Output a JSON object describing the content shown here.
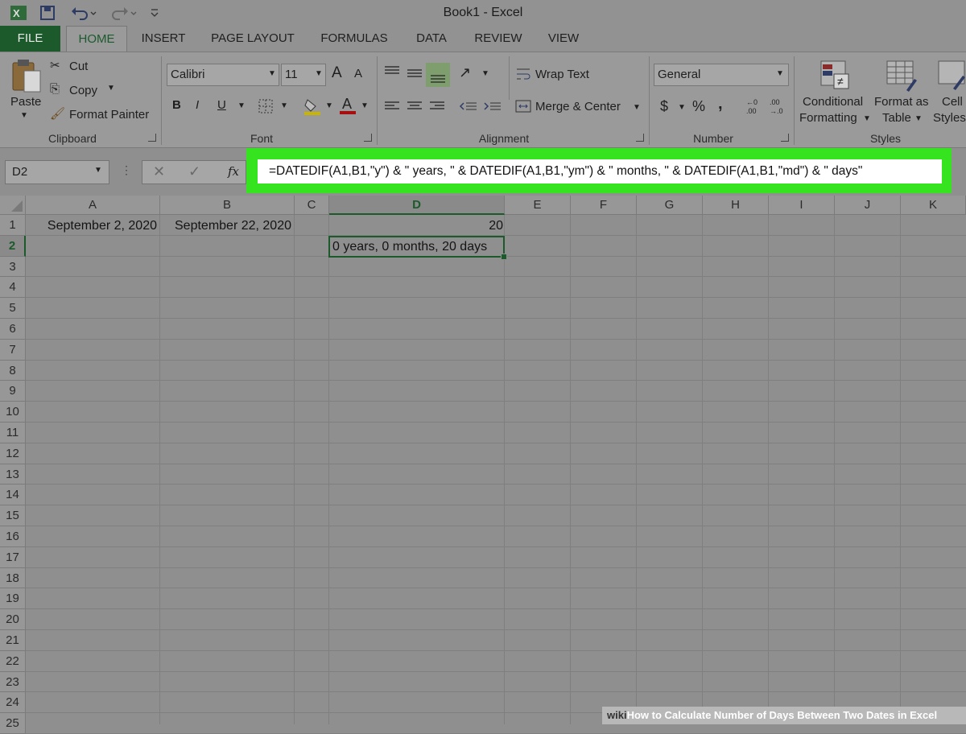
{
  "window": {
    "title": "Book1 - Excel"
  },
  "quick_access": {
    "excel_icon": "excel-icon",
    "save_icon": "save-icon",
    "undo_icon": "undo-icon",
    "redo_icon": "redo-icon",
    "customize_icon": "customize-icon"
  },
  "tabs": [
    {
      "label": "FILE"
    },
    {
      "label": "HOME"
    },
    {
      "label": "INSERT"
    },
    {
      "label": "PAGE LAYOUT"
    },
    {
      "label": "FORMULAS"
    },
    {
      "label": "DATA"
    },
    {
      "label": "REVIEW"
    },
    {
      "label": "VIEW"
    }
  ],
  "clipboard": {
    "paste": "Paste",
    "cut": "Cut",
    "copy": "Copy",
    "format_painter": "Format Painter",
    "label": "Clipboard"
  },
  "font": {
    "name": "Calibri",
    "size": "11",
    "bold": "B",
    "italic": "I",
    "underline": "U",
    "grow": "A",
    "shrink": "A",
    "label": "Font"
  },
  "alignment": {
    "wrap_text": "Wrap Text",
    "merge_center": "Merge & Center",
    "label": "Alignment"
  },
  "number": {
    "format": "General",
    "currency": "$",
    "percent": "%",
    "comma": ",",
    "label": "Number"
  },
  "styles": {
    "conditional_1": "Conditional",
    "conditional_2": "Formatting",
    "format_table_1": "Format as",
    "format_table_2": "Table",
    "cell_styles_1": "Cell",
    "cell_styles_2": "Styles",
    "label": "Styles"
  },
  "formula_bar": {
    "name_box": "D2",
    "fx": "fx",
    "formula": "=DATEDIF(A1,B1,\"y\") & \" years, \" & DATEDIF(A1,B1,\"ym\") & \" months, \" & DATEDIF(A1,B1,\"md\") & \" days\"",
    "highlight_color": "#35e41e"
  },
  "columns": [
    "A",
    "B",
    "C",
    "D",
    "E",
    "F",
    "G",
    "H",
    "I",
    "J",
    "K"
  ],
  "rows": [
    "1",
    "2",
    "3",
    "4",
    "5",
    "6",
    "7",
    "8",
    "9",
    "10",
    "11",
    "12",
    "13",
    "14",
    "15",
    "16",
    "17",
    "18",
    "19",
    "20",
    "21",
    "22",
    "23",
    "24",
    "25"
  ],
  "cells": {
    "A1": "September 2, 2020",
    "B1": "September 22, 2020",
    "D1": "20",
    "D2": "0 years, 0 months, 20 days"
  },
  "selected_cell": "D2",
  "watermark": {
    "prefix": "wiki",
    "text": "How to Calculate Number of Days Between Two Dates in Excel"
  }
}
